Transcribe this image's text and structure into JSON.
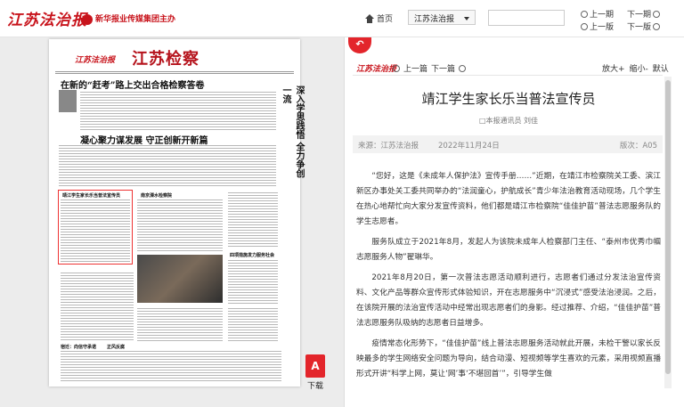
{
  "header": {
    "logo_text": "江苏法治报",
    "sublogo_text": "新华报业传媒集团主办",
    "home_label": "首页",
    "paper_select_value": "江苏法治报",
    "search_placeholder": "",
    "prev_page": "上一期",
    "next_page": "下一期",
    "prev_edition": "上一版",
    "next_edition": "下一版"
  },
  "newspaper": {
    "masthead": "江苏法治报",
    "section_title": "江苏检察",
    "headline_1": "在新的“赶考”路上交出合格检察答卷",
    "headline_2": "凝心聚力谋发展  守正创新开新篇",
    "vertical_headline": "深入学思践悟  全力争创一流",
    "small_hl_1": "靖江学生家长乐当普法宣传员",
    "small_hl_2": "南京溧水检察院",
    "small_hl_3": "四项措施发力服务社会",
    "small_hl_4": "宿迁：向信守承诺",
    "small_hl_5": "正风反腐"
  },
  "pdf": {
    "label": "下载",
    "icon_glyph": "A"
  },
  "article_toolbar": {
    "logo_text": "江苏法治报",
    "prev_article": "上一篇",
    "next_article": "下一篇",
    "zoom_in": "放大+",
    "zoom_out": "缩小-",
    "default": "默认"
  },
  "article": {
    "title": "靖江学生家长乐当普法宣传员",
    "author": "□本报通讯员 刘佳",
    "source": "来源：江苏法治报",
    "date": "2022年11月24日",
    "version": "版次：A05",
    "paragraphs": [
      "“您好，这是《未成年人保护法》宣传手册……”近期，在靖江市检察院关工委、滨江新区办事处关工委共同举办的“法润童心，护航成长”青少年法治教育活动现场，几个学生在热心地帮忙向大家分发宣传资料，他们都是靖江市检察院“佳佳护苗”普法志愿服务队的学生志愿者。",
      "服务队成立于2021年8月，发起人为该院未成年人检察部门主任、“泰州市优秀巾帼志愿服务人物”翟琳华。",
      "2021年8月20日，第一次普法志愿活动顺利进行，志愿者们通过分发法治宣传资料、文化产品等群众宣传形式体验知识，开在志愿服务中“沉浸式”感受法治浸润。之后，在该院开展的法治宣传活动中经常出现志愿者们的身影。经过推荐、介绍，“佳佳护苗”普法志愿服务队吸纳的志愿者日益增多。",
      "疫情常态化形势下，“佳佳护苗”线上普法志愿服务活动就此开展，未检干警以家长反映最多的学生网络安全问题为导向，结合动漫、短视频等学生喜欢的元素，采用视频直播形式开讲“科学上网，莫让‘网’事‘不堪回首’”，引导学生做"
    ]
  },
  "colors": {
    "brand_red": "#c8141c",
    "pdf_red": "#e3252b"
  }
}
